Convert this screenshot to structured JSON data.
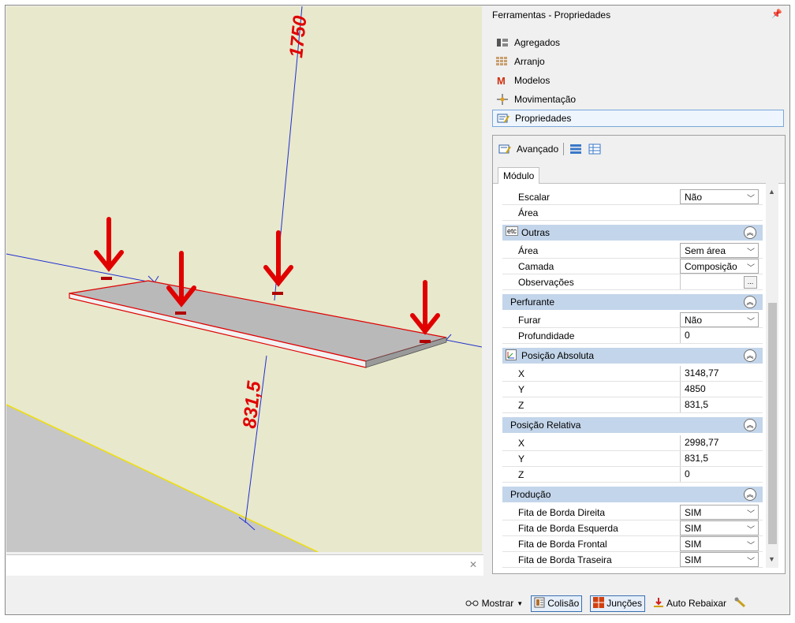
{
  "panel": {
    "title": "Ferramentas - Propriedades"
  },
  "nav": [
    {
      "label": "Agregados",
      "icon": "aggregates-icon"
    },
    {
      "label": "Arranjo",
      "icon": "arrangement-icon"
    },
    {
      "label": "Modelos",
      "icon": "models-icon"
    },
    {
      "label": "Movimentação",
      "icon": "move-icon"
    },
    {
      "label": "Propriedades",
      "icon": "properties-icon",
      "active": true
    }
  ],
  "props": {
    "toolbar_label": "Avançado",
    "tab": "Módulo",
    "rows": {
      "escalar": {
        "label": "Escalar",
        "value": "Não"
      },
      "area_top": {
        "label": "Área",
        "value": ""
      },
      "outras": {
        "label": "Outras",
        "icon_text": "etc"
      },
      "area": {
        "label": "Área",
        "value": "Sem área"
      },
      "camada": {
        "label": "Camada",
        "value": "Composição"
      },
      "observacoes": {
        "label": "Observações",
        "value": ""
      },
      "perfurante": {
        "label": "Perfurante"
      },
      "furar": {
        "label": "Furar",
        "value": "Não"
      },
      "profundidade": {
        "label": "Profundidade",
        "value": "0"
      },
      "pos_abs": {
        "label": "Posição Absoluta"
      },
      "abs_x": {
        "label": "X",
        "value": "3148,77"
      },
      "abs_y": {
        "label": "Y",
        "value": "4850"
      },
      "abs_z": {
        "label": "Z",
        "value": "831,5"
      },
      "pos_rel": {
        "label": "Posição Relativa"
      },
      "rel_x": {
        "label": "X",
        "value": "2998,77"
      },
      "rel_y": {
        "label": "Y",
        "value": "831,5"
      },
      "rel_z": {
        "label": "Z",
        "value": "0"
      },
      "producao": {
        "label": "Produção"
      },
      "fita_dir": {
        "label": "Fita de Borda Direita",
        "value": "SIM"
      },
      "fita_esq": {
        "label": "Fita de Borda Esquerda",
        "value": "SIM"
      },
      "fita_fro": {
        "label": "Fita de Borda Frontal",
        "value": "SIM"
      },
      "fita_tra": {
        "label": "Fita de Borda Traseira",
        "value": "SIM"
      }
    }
  },
  "viewport": {
    "dimension_top": "1750",
    "dimension_bottom": "831,5",
    "colors": {
      "wall": "#e8e8cc",
      "floor": "#c8c8c8",
      "dimension": "#e00000",
      "axis": "#0000ff",
      "arrow": "#e00000"
    }
  },
  "statusbar": {
    "mostrar": "Mostrar",
    "colisao": "Colisão",
    "juncoes": "Junções",
    "auto_rebaixar": "Auto Rebaixar"
  }
}
